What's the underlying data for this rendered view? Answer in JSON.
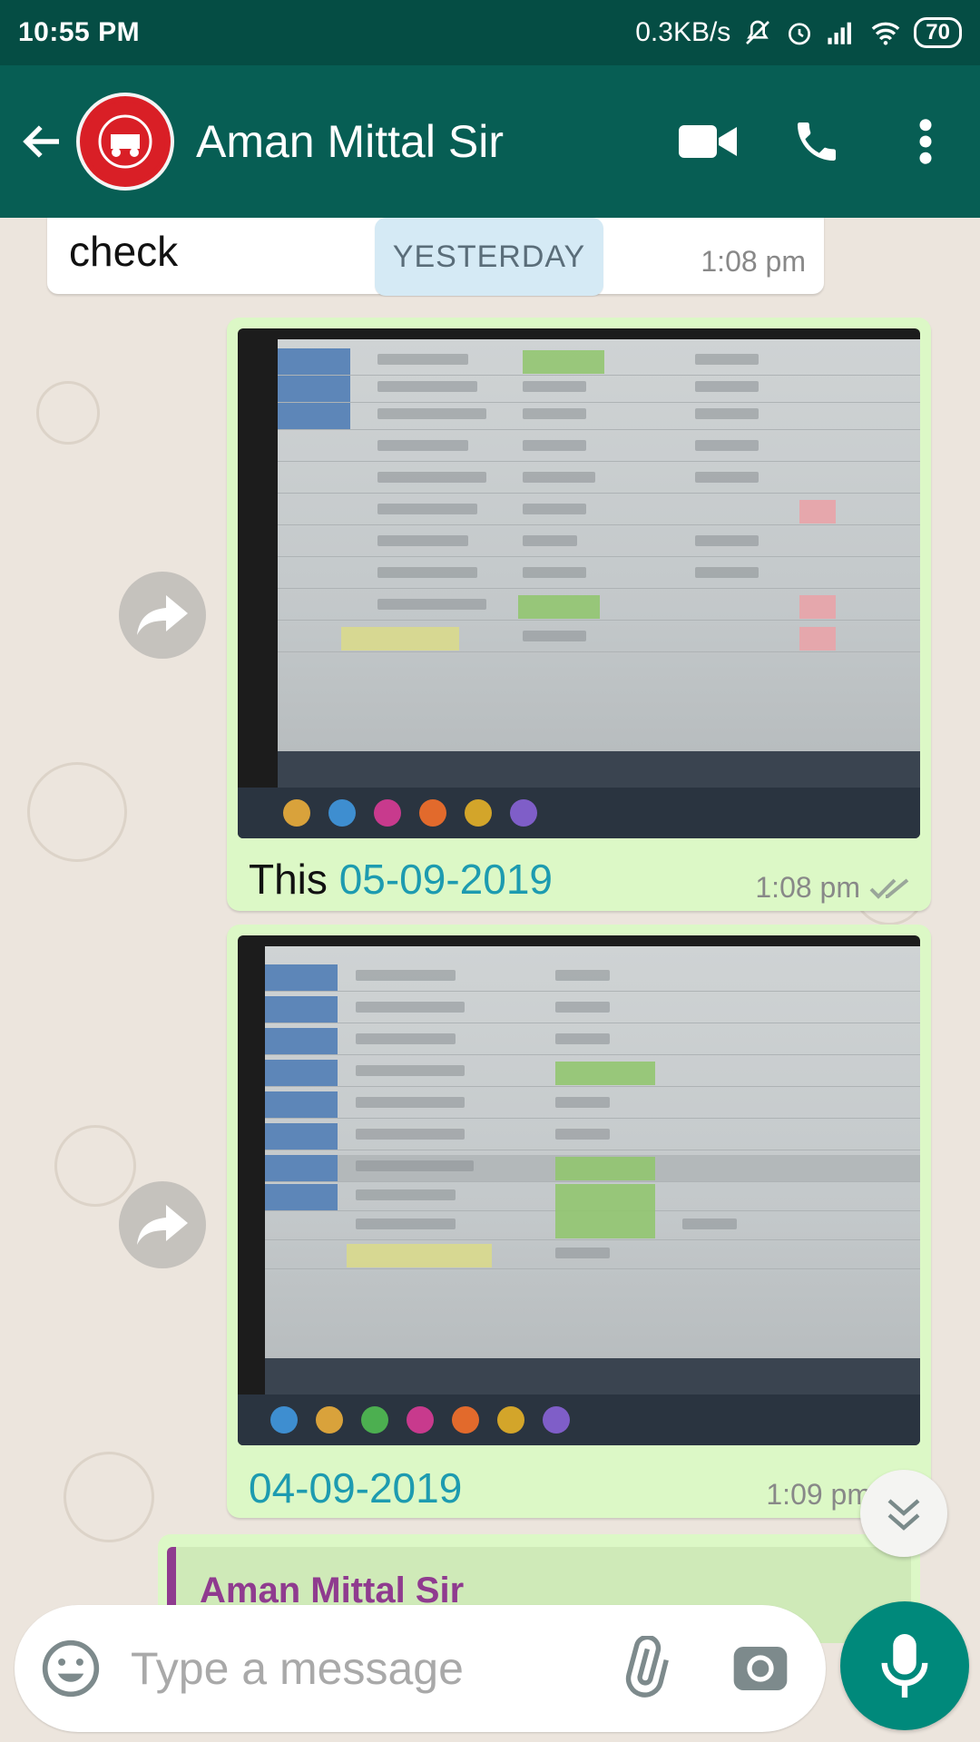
{
  "status_bar": {
    "time": "10:55 PM",
    "network_speed": "0.3KB/s",
    "battery": "70",
    "icons": [
      "mute-bell-icon",
      "alarm-icon",
      "signal-icon",
      "wifi-icon",
      "battery-icon"
    ]
  },
  "header": {
    "contact_name": "Aman Mittal Sir",
    "avatar_icon": "indian-railways-logo",
    "actions": [
      "video-call-icon",
      "voice-call-icon",
      "more-options-icon"
    ]
  },
  "date_chip": "YESTERDAY",
  "messages": [
    {
      "type": "incoming-text",
      "text": "check",
      "time": "1:08 pm"
    },
    {
      "type": "outgoing-image",
      "caption_prefix": "This ",
      "caption_date": "05-09-2019",
      "time": "1:08 pm",
      "status": "read"
    },
    {
      "type": "outgoing-image",
      "caption_prefix": "",
      "caption_date": "04-09-2019",
      "time": "1:09 pm",
      "status": "read"
    },
    {
      "type": "outgoing-reply",
      "quoted_name": "Aman Mittal Sir"
    }
  ],
  "input": {
    "placeholder": "Type a message"
  },
  "colors": {
    "header": "#075e54",
    "status_bar": "#054d44",
    "outgoing_bubble": "#dcf8c6",
    "link_date": "#1d9bb0",
    "mic_button": "#00897b"
  }
}
